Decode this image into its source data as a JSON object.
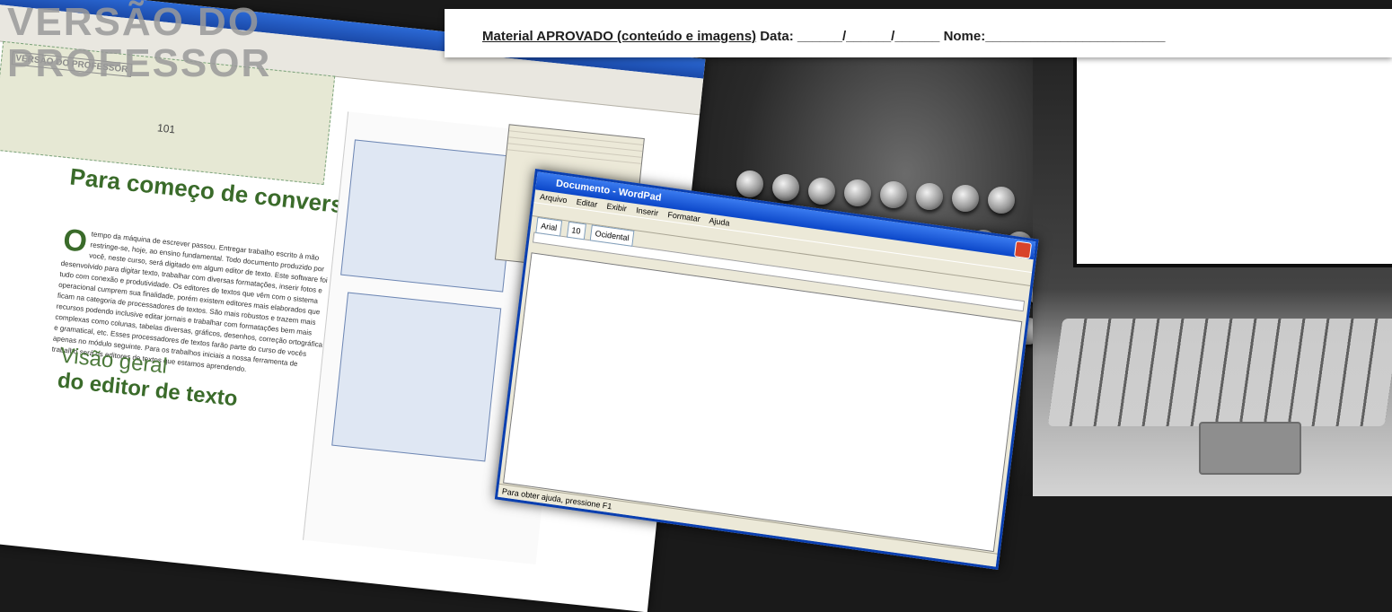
{
  "approval": {
    "label": "Material APROVADO (conteúdo e imagens)",
    "date_label": "Data: ______/______/______",
    "name_label": "Nome:________________________"
  },
  "layout_app": {
    "stamp": "VERSÃO DO PROFESSOR",
    "stamp_small": "VERSÃO DO PROFESSOR",
    "page_number": "101",
    "heading_1": "Para começo de conversa...",
    "dropcap": "O",
    "paragraph_1": "tempo da máquina de escrever passou. Entregar trabalho escrito à mão restringe-se, hoje, ao ensino fundamental. Todo documento produzido por você, neste curso, será digitado em algum editor de texto. Este software foi desenvolvido para digitar texto, trabalhar com diversas formatações, inserir fotos e tudo com conexão e produtividade. Os editores de textos que vêm com o sistema operacional cumprem sua finalidade, porém existem editores mais elaborados que ficam na categoria de processadores de textos. São mais robustos e trazem mais recursos podendo inclusive editar jornais e trabalhar com formatações bem mais complexas como colunas, tabelas diversas, gráficos, desenhos, correção ortográfica e gramatical, etc. Esses processadores de textos farão parte do curso de vocês apenas no módulo seguinte. Para os trabalhos iniciais a nossa ferramenta de trabalho será os editores de textos que estamos aprendendo.",
    "heading_2_light": "Visão geral",
    "heading_2_bold": "do editor de texto"
  },
  "wordpad": {
    "title": "Documento - WordPad",
    "menu": [
      "Arquivo",
      "Editar",
      "Exibir",
      "Inserir",
      "Formatar",
      "Ajuda"
    ],
    "font": "Arial",
    "size": "10",
    "script": "Ocidental",
    "status": "Para obter ajuda, pressione F1"
  }
}
